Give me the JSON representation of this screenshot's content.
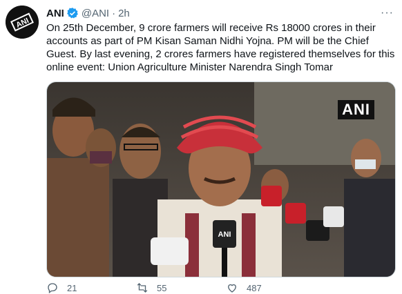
{
  "tweet": {
    "author_name": "ANI",
    "handle": "@ANI",
    "separator": "·",
    "time": "2h",
    "text": "On 25th December, 9 crore farmers will receive Rs 18000 crores in their accounts as part of PM Kisan Saman Nidhi Yojna. PM will be the Chief Guest. By last evening, 2 crores farmers have registered themselves for this online event: Union Agriculture Minister Narendra Singh Tomar",
    "media_watermark": "ANI",
    "mic_logo": "ANI",
    "more_label": "···"
  },
  "actions": {
    "reply_count": "21",
    "retweet_count": "55",
    "like_count": "487"
  },
  "colors": {
    "verified": "#1d9bf0",
    "secondary_text": "#536471",
    "turban": "#c8303a"
  },
  "icons": [
    "verified-badge-icon",
    "more-icon",
    "reply-icon",
    "retweet-icon",
    "like-icon"
  ]
}
